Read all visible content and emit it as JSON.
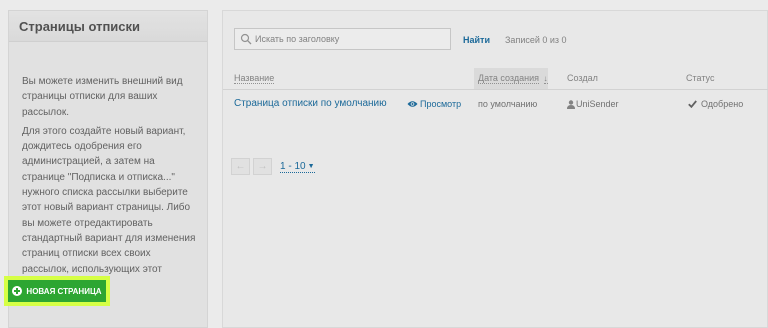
{
  "sidebar": {
    "title": "Страницы отписки",
    "paragraphs": [
      "Вы можете изменить внешний вид страницы отписки для ваших рассылок.",
      "Для этого создайте новый вариант, дождитесь одобрения его администрацией, а затем на странице \"Подписка и отписка...\" нужного списка рассылки выберите этот новый вариант страницы. Либо вы можете отредактировать стандартный вариант для изменения страниц отписки всех своих рассылок, использующих этот вариант."
    ],
    "new_page_button": "НОВАЯ СТРАНИЦА"
  },
  "toolbar": {
    "search_placeholder": "Искать по заголовку",
    "find_label": "Найти",
    "records_label": "Записей 0 из 0"
  },
  "table": {
    "columns": {
      "name": "Название",
      "date": "Дата создания",
      "creator": "Создал",
      "status": "Статус"
    },
    "rows": [
      {
        "name": "Страница отписки по умолчанию",
        "preview": "Просмотр",
        "date": "по умолчанию",
        "creator": "UniSender",
        "status": "Одобрено"
      }
    ]
  },
  "pager": {
    "range": "1 - 10"
  },
  "icons": {
    "search": "search-icon",
    "eye": "eye-icon",
    "user": "user-icon",
    "check": "check-icon",
    "plus": "plus-icon"
  },
  "colors": {
    "accent_link": "#1d6ea0",
    "button_green": "#2da632",
    "button_highlight": "#d6ff45"
  }
}
